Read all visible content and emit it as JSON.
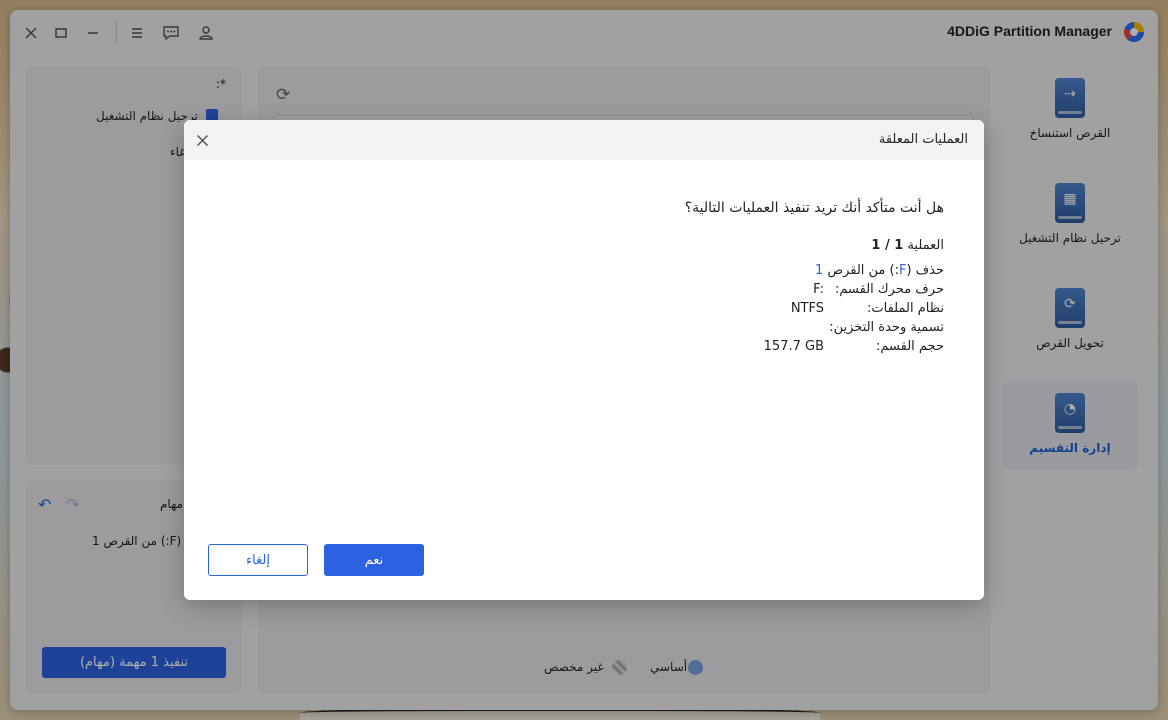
{
  "app": {
    "title": "4DDiG Partition Manager"
  },
  "nav": [
    {
      "label": "القرص استنساخ",
      "icon": "disk-clone-icon"
    },
    {
      "label": "ترحيل نظام التشغيل",
      "icon": "os-migration-icon"
    },
    {
      "label": "تحويل القرص",
      "icon": "disk-convert-icon"
    },
    {
      "label": "إدارة التقسيم",
      "icon": "partition-manage-icon",
      "active": true
    }
  ],
  "left_top": {
    "header": ":*",
    "item": "ترحيل نظام التشغيل",
    "item2": "غاء"
  },
  "tasks": {
    "title": "مهام",
    "item": "(F:) من القرص 1",
    "execute": "تنفيذ 1 مهمة (مهام)"
  },
  "legend": {
    "basic": "أساسي",
    "unallocated": "غير مخصص"
  },
  "dialog": {
    "title": "العمليات المعلقة",
    "question": "هل أنت متأكد أنك تريد تنفيذ العمليات التالية؟",
    "op_label": "العملية",
    "op_counter": "1 / 1",
    "delete_line": {
      "prefix": "حذف (",
      "drive": "F",
      "middle": ":) من القرص ",
      "disk": "1"
    },
    "fields": [
      {
        "label": "حرف محرك القسم:",
        "value": "F:"
      },
      {
        "label": "نظام الملفات:",
        "value": "NTFS"
      },
      {
        "label": "تسمية وحدة التخزين:",
        "value": ""
      },
      {
        "label": "حجم القسم:",
        "value": "157.7 GB"
      }
    ],
    "yes": "نعم",
    "cancel": "إلغاء"
  },
  "colors": {
    "accent": "#2c62e0"
  }
}
